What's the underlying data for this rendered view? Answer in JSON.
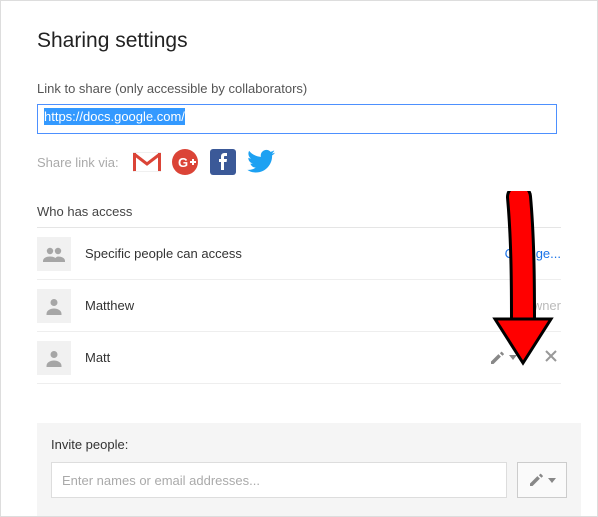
{
  "title": "Sharing settings",
  "link_section": {
    "label": "Link to share (only accessible by collaborators)",
    "url": "https://docs.google.com/"
  },
  "share_via": {
    "label": "Share link via:",
    "services": [
      "gmail",
      "google-plus",
      "facebook",
      "twitter"
    ]
  },
  "access": {
    "heading": "Who has access",
    "visibility": {
      "text": "Specific people can access",
      "action": "Change..."
    },
    "people": [
      {
        "name": "Matthew",
        "role": "Is owner",
        "removable": false
      },
      {
        "name": "Matt",
        "role": "Can edit",
        "removable": true
      }
    ]
  },
  "invite": {
    "label": "Invite people:",
    "placeholder": "Enter names or email addresses..."
  },
  "annotation": {
    "type": "arrow",
    "color": "#ff0000",
    "points_to": "remove-person-button"
  }
}
